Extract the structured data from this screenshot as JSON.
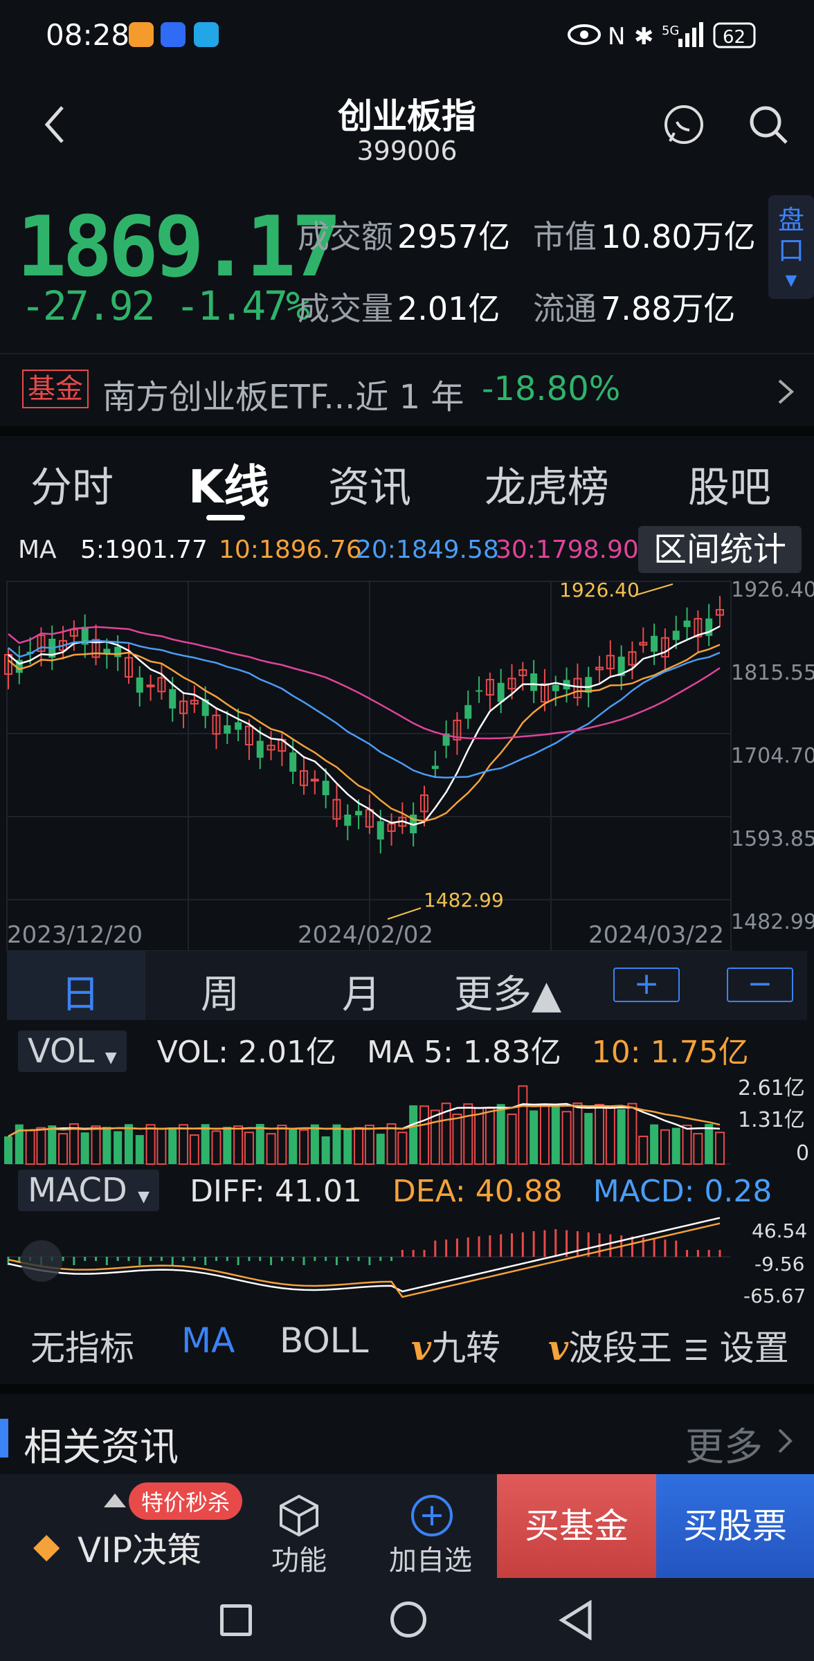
{
  "status": {
    "time": "08:28",
    "battery": "62",
    "network": "5G"
  },
  "header": {
    "title": "创业板指",
    "code": "399006",
    "icons": [
      "back-arrow-icon",
      "chat-icon",
      "search-icon"
    ]
  },
  "quote": {
    "price": "1869.17",
    "change": "-27.92",
    "change_pct": "-1.47%",
    "turnover_label": "成交额",
    "turnover": "2957亿",
    "mktcap_label": "市值",
    "mktcap": "10.80万亿",
    "volume_label": "成交量",
    "volume": "2.01亿",
    "float_label": "流通",
    "float": "7.88万亿",
    "pankou": [
      "盘",
      "口"
    ]
  },
  "fund": {
    "badge": "基金",
    "name": "南方创业板ETF...近 1 年",
    "perf": "-18.80%"
  },
  "tabs": [
    "分时",
    "K线",
    "资讯",
    "龙虎榜",
    "股吧"
  ],
  "ma_line": {
    "label": "MA",
    "ma5": "5:1901.77",
    "ma10": "10:1896.76",
    "ma20": "20:1849.58",
    "ma30": "30:1798.90"
  },
  "interval_btn": "区间统计",
  "kline": {
    "y_ticks": [
      "1926.40",
      "1815.55",
      "1704.70",
      "1593.85",
      "1482.99"
    ],
    "dates": [
      "2023/12/20",
      "2024/02/02",
      "2024/03/22"
    ],
    "high_label": "1926.40",
    "low_label": "1482.99"
  },
  "periods": [
    "日",
    "周",
    "月",
    "更多▲"
  ],
  "zoom": {
    "in": "+",
    "out": "−"
  },
  "vol": {
    "dropdown": "VOL",
    "vol": "VOL:  2.01亿",
    "ma5": "MA 5:  1.83亿",
    "ma10": "10:  1.75亿",
    "ticks": [
      "2.61亿",
      "1.31亿",
      "0"
    ]
  },
  "macd": {
    "dropdown": "MACD",
    "diff": "DIFF: 41.01",
    "dea": "DEA: 40.88",
    "macd": "MACD: 0.28",
    "ticks": [
      "46.54",
      "-9.56",
      "-65.67"
    ]
  },
  "indicators": [
    "无指标",
    "MA",
    "BOLL",
    "九转",
    "波段王",
    "设置"
  ],
  "news": {
    "title": "相关资讯",
    "more": "更多"
  },
  "footer": {
    "promo": "特价秒杀",
    "vip": "VIP决策",
    "func": "功能",
    "add": "加自选",
    "buy_fund": "买基金",
    "buy_stock": "买股票"
  },
  "colors": {
    "up": "#e84a4a",
    "down": "#2fb36b",
    "ma5": "#ffffff",
    "ma10": "#f5a23a",
    "ma20": "#4a9df5",
    "ma30": "#e0449a",
    "accent": "#3b82f6"
  }
}
